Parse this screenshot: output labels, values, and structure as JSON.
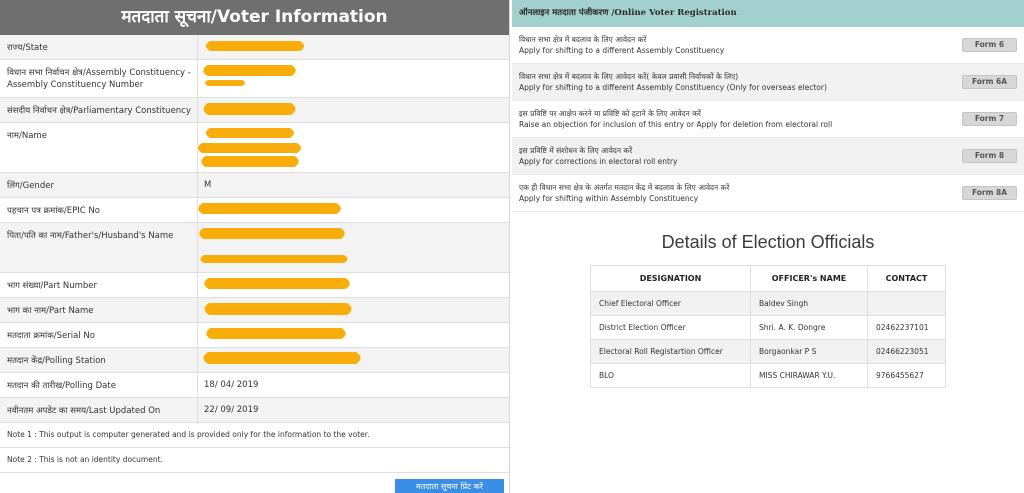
{
  "voter": {
    "title": "मतदाता सूचना/Voter Information",
    "rows": [
      {
        "label": "राज्य/State",
        "value": ""
      },
      {
        "label": "विधान सभा निर्वाचन क्षेत्र/Assembly Constituency - Assembly Constituency Number",
        "value": ""
      },
      {
        "label": "संसदीय निर्वाचन क्षेत्र/Parliamentary Constituency",
        "value": ""
      },
      {
        "label": "नाम/Name",
        "value": ""
      },
      {
        "label": "लिंग/Gender",
        "value": "M"
      },
      {
        "label": "पहचान पत्र क्रमांक/EPIC No",
        "value": ""
      },
      {
        "label": "पिता/पति का नाम/Father's/Husband's Name",
        "value": ""
      },
      {
        "label": "भाग संख्या/Part Number",
        "value": ""
      },
      {
        "label": "भाग का नाम/Part Name",
        "value": ""
      },
      {
        "label": "मतदाता क्रमांक/Serial No",
        "value": ""
      },
      {
        "label": "मतदान केंद्र/Polling Station",
        "value": ""
      },
      {
        "label": "मतदान की तारीख/Polling Date",
        "value": "18/ 04/ 2019"
      },
      {
        "label": "नवीनतम अपडेट का समय/Last Updated On",
        "value": "22/ 09/ 2019"
      }
    ],
    "note1": "Note 1 : This output is computer generated and is provided only for the information to the voter.",
    "note2": "Note 2 : This is not an identity document.",
    "print_label": "मतदाता सूचना प्रिंट करें"
  },
  "online": {
    "header": "ऑनलाइन मतदाता पंजीकरण /Online Voter Registration",
    "forms": [
      {
        "hi": "विधान सभा क्षेत्र में बदलाव के लिए आवेदन करें",
        "en": "Apply for shifting to a different Assembly Constituency",
        "btn": "Form 6"
      },
      {
        "hi": "विधान सभा क्षेत्र में बदलाव के लिए आवेदन करें( केवल प्रवासी निर्वाचकों के लिए)",
        "en": "Apply for shifting to a different Assembly Constituency (Only for overseas elector)",
        "btn": "Form 6A"
      },
      {
        "hi": "इस प्रविष्टि पर आक्षेप करने या प्रविष्टि को हटाने के लिए आवेदन करें",
        "en": "Raise an objection for inclusion of this entry or Apply for deletion from electoral roll",
        "btn": "Form 7"
      },
      {
        "hi": "इस प्रविष्टि में संशोधन के लिए आवेदन करें",
        "en": "Apply for corrections in electoral roll entry",
        "btn": "Form 8"
      },
      {
        "hi": "एक ही विधान सभा क्षेत्र के अंतर्गत मतदान केंद्र में बदलाव के लिए आवेदन करें",
        "en": "Apply for shifting within Assembly Constituency",
        "btn": "Form 8A"
      }
    ]
  },
  "officials": {
    "title": "Details of Election Officials",
    "headers": [
      "DESIGNATION",
      "OFFICER's NAME",
      "CONTACT"
    ],
    "rows": [
      [
        "Chief Electoral Officer",
        "Baldev Singh",
        ""
      ],
      [
        "District Election Officer",
        "Shri. A. K. Dongre",
        "02462237101"
      ],
      [
        "Electoral Roll Registartion Officer",
        "Borgaonkar P S",
        "02466223051"
      ],
      [
        "BLO",
        "MISS CHIRAWAR Y.U.",
        "9766455627"
      ]
    ]
  },
  "colors": {
    "title_bar": "#6f6f6f",
    "redaction": "#f9ad0a",
    "online_header": "#a2d0cf",
    "print_button": "#3a8ee6"
  }
}
